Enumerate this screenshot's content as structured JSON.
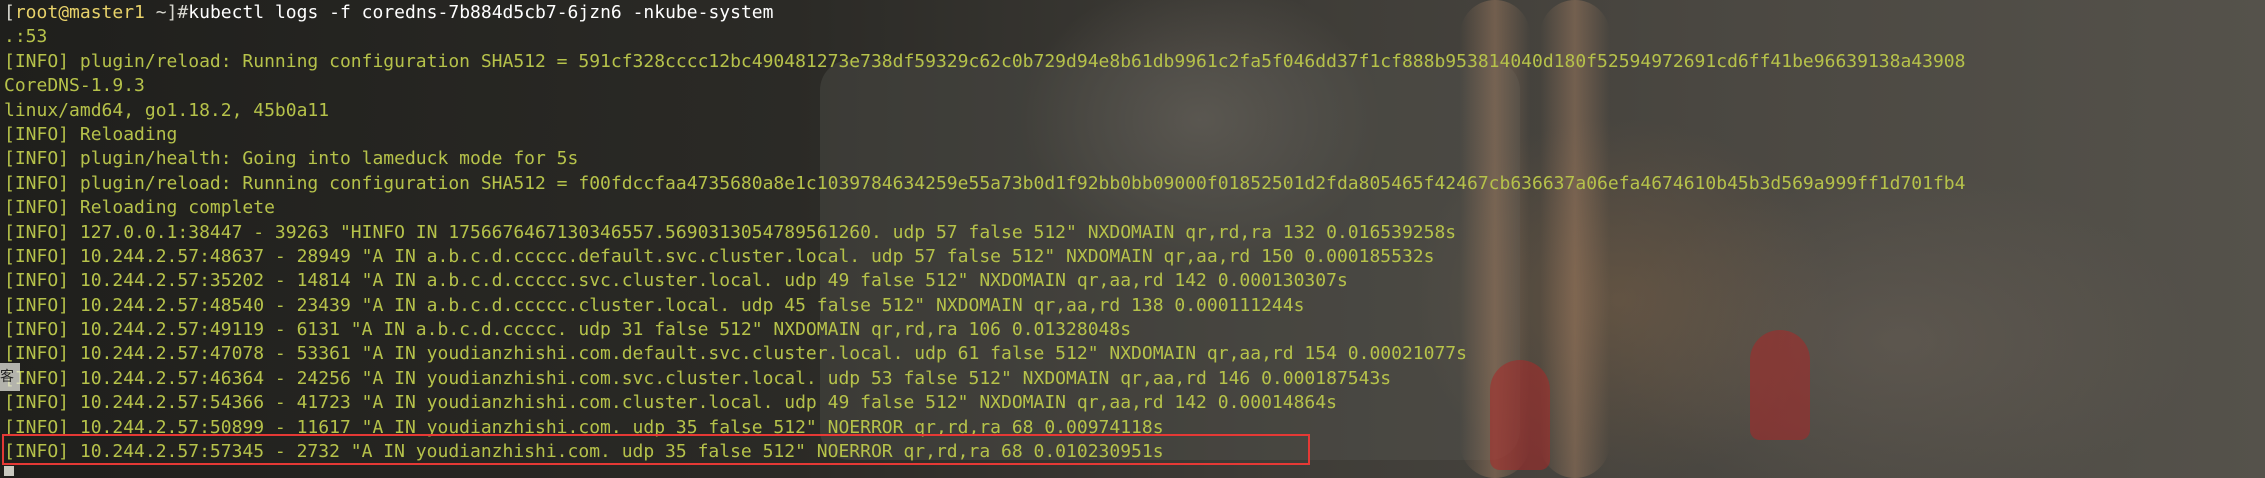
{
  "terminal": {
    "prompt": {
      "open_bracket": "[",
      "user": "root",
      "at_host": "@master1",
      "path": " ~]",
      "hash": "#",
      "command": "kubectl logs -f coredns-7b884d5cb7-6jzn6 -nkube-system"
    },
    "output_lines": [
      ".:53",
      "[INFO] plugin/reload: Running configuration SHA512 = 591cf328cccc12bc490481273e738df59329c62c0b729d94e8b61db9961c2fa5f046dd37f1cf888b953814040d180f52594972691cd6ff41be96639138a43908",
      "CoreDNS-1.9.3",
      "linux/amd64, go1.18.2, 45b0a11",
      "[INFO] Reloading",
      "[INFO] plugin/health: Going into lameduck mode for 5s",
      "[INFO] plugin/reload: Running configuration SHA512 = f00fdccfaa4735680a8e1c1039784634259e55a73b0d1f92bb0bb09000f01852501d2fda805465f42467cb636637a06efa4674610b45b3d569a999ff1d701fb4",
      "[INFO] Reloading complete",
      "[INFO] 127.0.0.1:38447 - 39263 \"HINFO IN 1756676467130346557.5690313054789561260. udp 57 false 512\" NXDOMAIN qr,rd,ra 132 0.016539258s",
      "[INFO] 10.244.2.57:48637 - 28949 \"A IN a.b.c.d.ccccc.default.svc.cluster.local. udp 57 false 512\" NXDOMAIN qr,aa,rd 150 0.000185532s",
      "[INFO] 10.244.2.57:35202 - 14814 \"A IN a.b.c.d.ccccc.svc.cluster.local. udp 49 false 512\" NXDOMAIN qr,aa,rd 142 0.000130307s",
      "[INFO] 10.244.2.57:48540 - 23439 \"A IN a.b.c.d.ccccc.cluster.local. udp 45 false 512\" NXDOMAIN qr,aa,rd 138 0.000111244s",
      "[INFO] 10.244.2.57:49119 - 6131 \"A IN a.b.c.d.ccccc. udp 31 false 512\" NXDOMAIN qr,rd,ra 106 0.01328048s",
      "[INFO] 10.244.2.57:47078 - 53361 \"A IN youdianzhishi.com.default.svc.cluster.local. udp 61 false 512\" NXDOMAIN qr,aa,rd 154 0.00021077s",
      "[INFO] 10.244.2.57:46364 - 24256 \"A IN youdianzhishi.com.svc.cluster.local. udp 53 false 512\" NXDOMAIN qr,aa,rd 146 0.000187543s",
      "[INFO] 10.244.2.57:54366 - 41723 \"A IN youdianzhishi.com.cluster.local. udp 49 false 512\" NXDOMAIN qr,aa,rd 142 0.00014864s",
      "[INFO] 10.244.2.57:50899 - 11617 \"A IN youdianzhishi.com. udp 35 false 512\" NOERROR qr,rd,ra 68 0.00974118s",
      "[INFO] 10.244.2.57:57345 - 2732 \"A IN youdianzhishi.com. udp 35 false 512\" NOERROR qr,rd,ra 68 0.010230951s"
    ],
    "side_tab_text": "客户",
    "text_color": "#b6c24a",
    "highlight_color": "#e53935"
  }
}
